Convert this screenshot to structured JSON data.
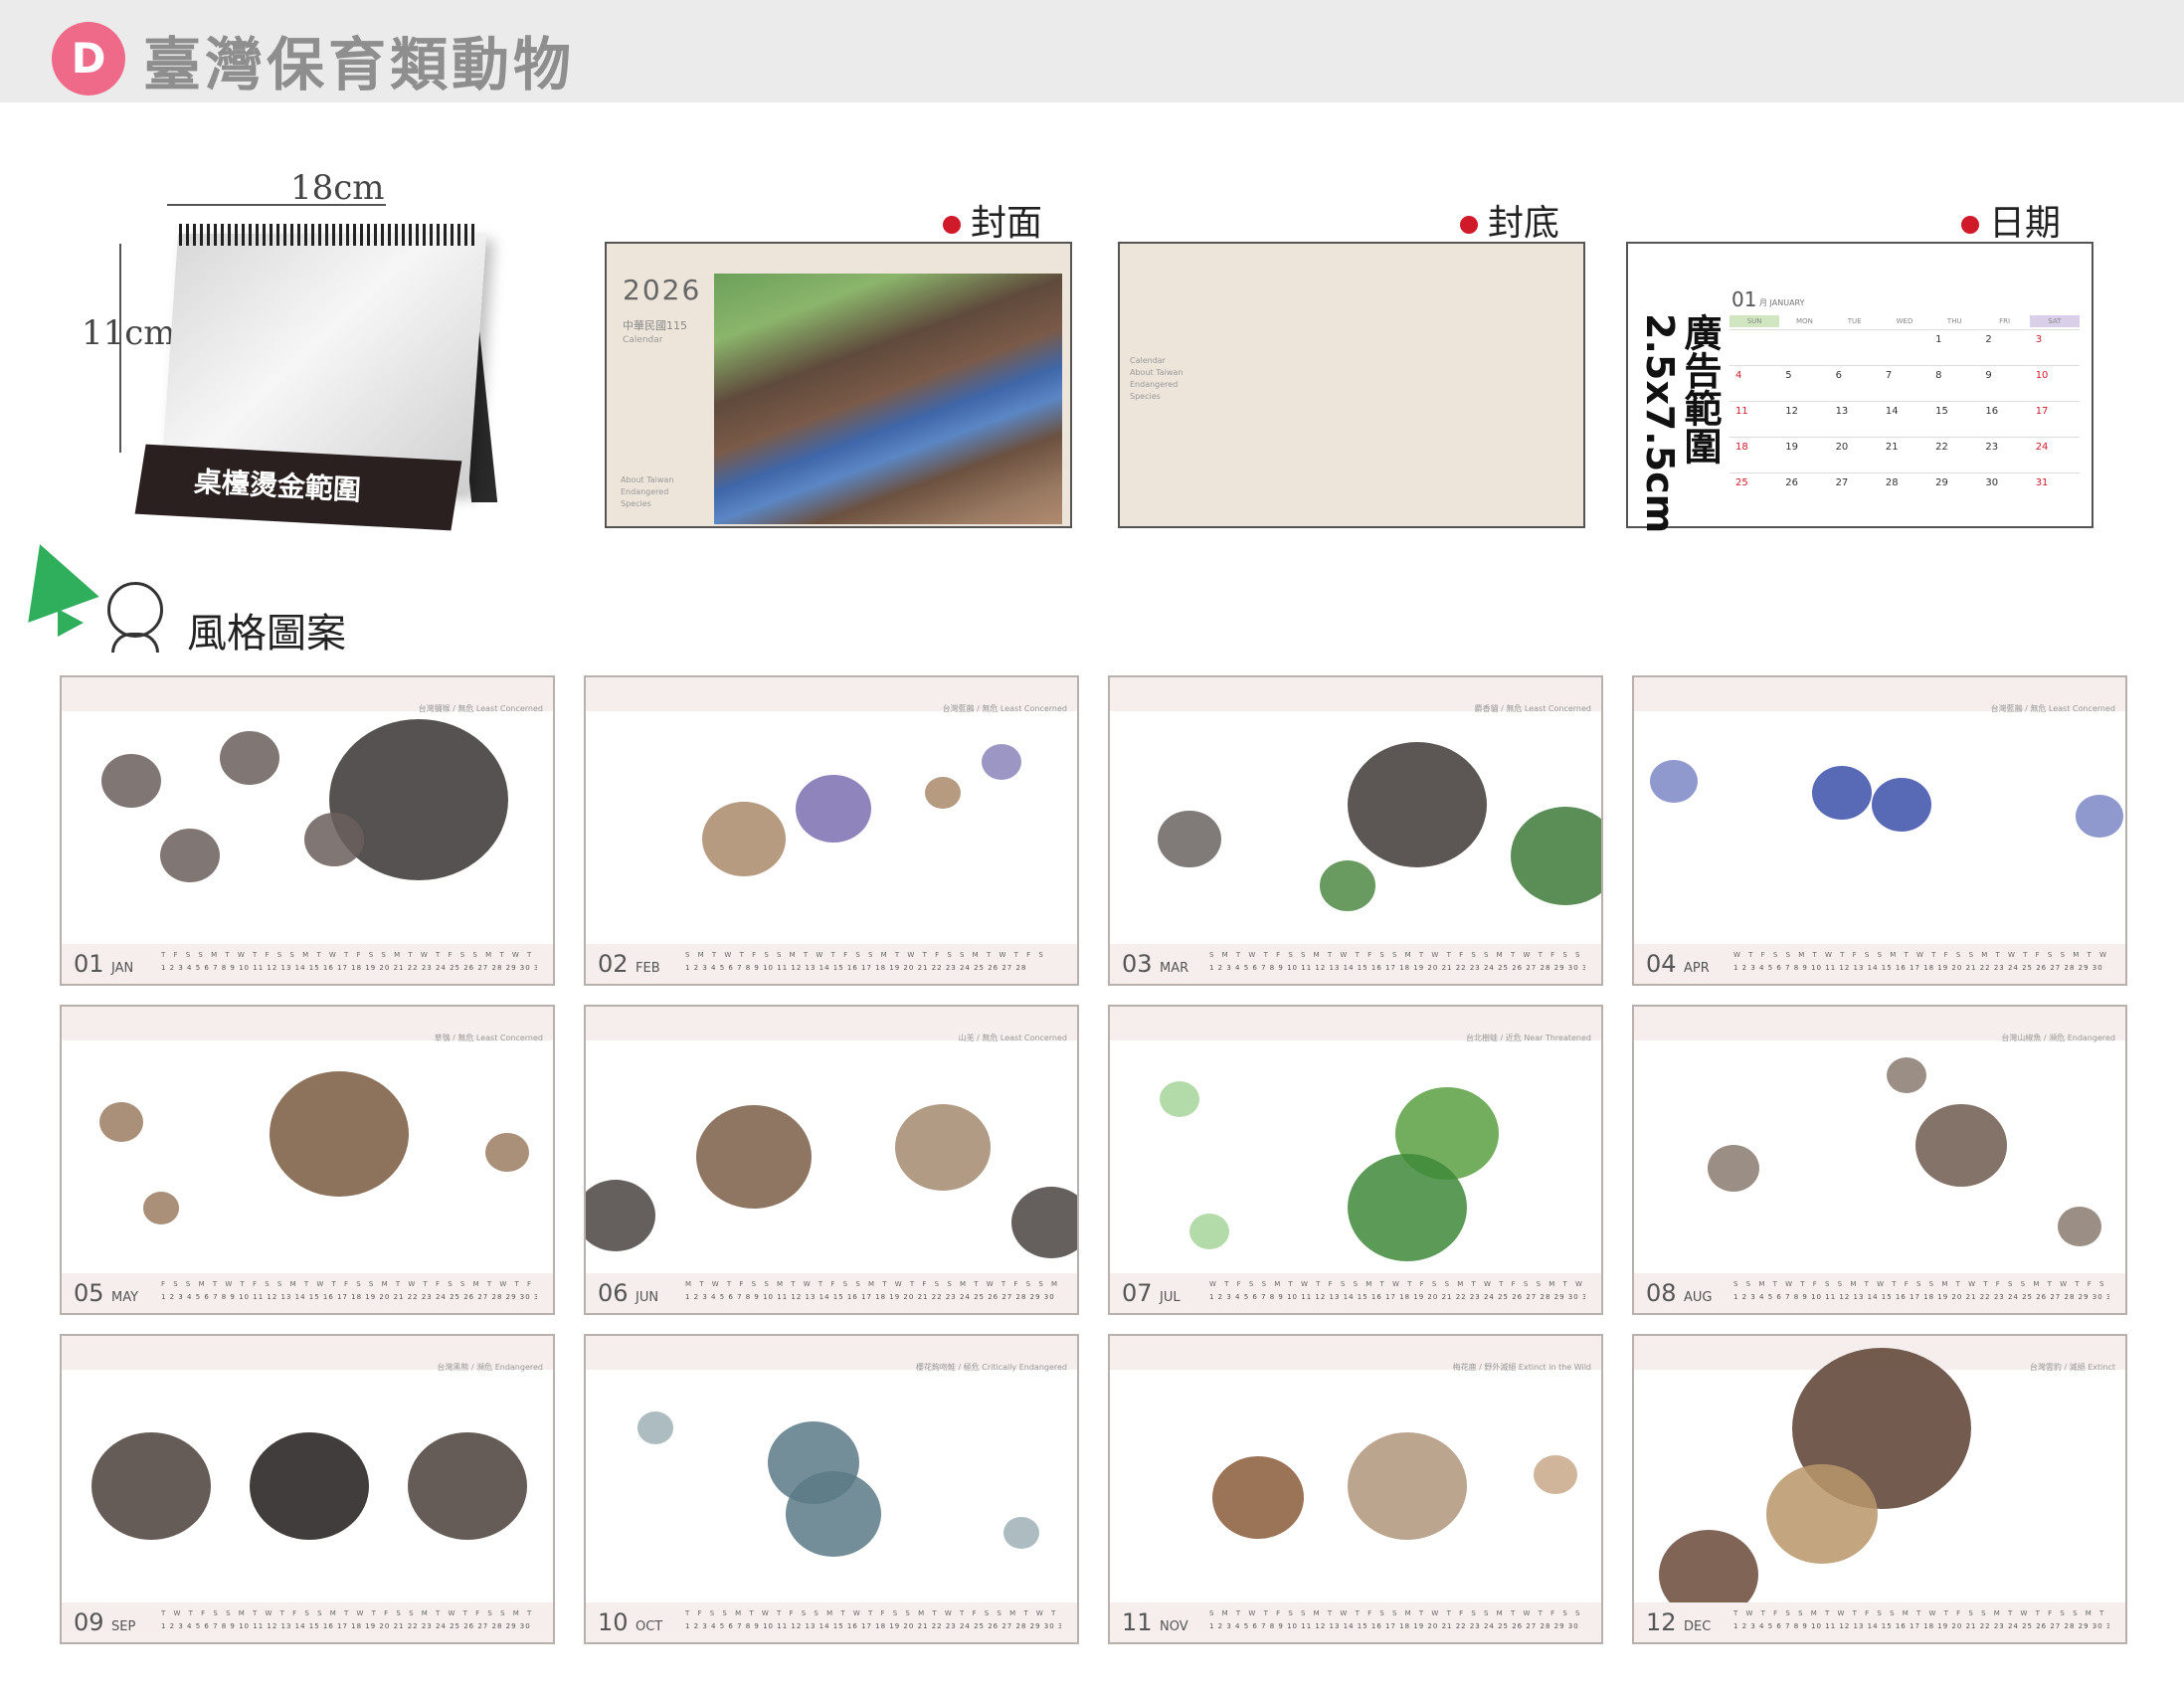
{
  "header": {
    "badge": "D",
    "title": "臺灣保育類動物"
  },
  "desk": {
    "width_label": "18cm",
    "height_label": "11cm",
    "base_label": "桌檯燙金範圍"
  },
  "previews": {
    "cover": {
      "label": "封面",
      "year": "2026",
      "roc": "中華民國115",
      "cal": "Calendar",
      "about": "About Taiwan Endangered Species"
    },
    "back": {
      "label": "封底",
      "text": "Calendar About Taiwan Endangered Species"
    },
    "date": {
      "label": "日期",
      "ad": "廣告範圍2.5x7.5cm",
      "month": "01",
      "monthname": "月 JANUARY",
      "weekdays": [
        "SUN",
        "MON",
        "TUE",
        "WED",
        "THU",
        "FRI",
        "SAT"
      ],
      "rows": [
        [
          "",
          "",
          "",
          "",
          "1",
          "2",
          "3"
        ],
        [
          "4",
          "5",
          "6",
          "7",
          "8",
          "9",
          "10"
        ],
        [
          "11",
          "12",
          "13",
          "14",
          "15",
          "16",
          "17"
        ],
        [
          "18",
          "19",
          "20",
          "21",
          "22",
          "23",
          "24"
        ],
        [
          "25",
          "26",
          "27",
          "28",
          "29",
          "30",
          "31"
        ]
      ]
    }
  },
  "style": {
    "title": "風格圖案"
  },
  "months": [
    {
      "num": "01",
      "abbr": "JAN",
      "caption": "台灣獼猴 / 無危 Least Concerned",
      "weekdays": "T F S S M T W T F S S M T W T F S S M T W T F S S M T W T F S",
      "days": "1 2 3 4 5 6 7 8 9 10 11 12 13 14 15 16 17 18 19 20 21 22 23 24 25 26 27 28 29 30 31"
    },
    {
      "num": "02",
      "abbr": "FEB",
      "caption": "台灣藍鵲 / 無危 Least Concerned",
      "weekdays": "S M T W T F S S M T W T F S S M T W T F S S M T W T F S",
      "days": "1 2 3 4 5 6 7 8 9 10 11 12 13 14 15 16 17 18 19 20 21 22 23 24 25 26 27 28"
    },
    {
      "num": "03",
      "abbr": "MAR",
      "caption": "麝香貓 / 無危 Least Concerned",
      "weekdays": "S M T W T F S S M T W T F S S M T W T F S S M T W T F S S M T",
      "days": "1 2 3 4 5 6 7 8 9 10 11 12 13 14 15 16 17 18 19 20 21 22 23 24 25 26 27 28 29 30 31"
    },
    {
      "num": "04",
      "abbr": "APR",
      "caption": "台灣藍鵲 / 無危 Least Concerned",
      "weekdays": "W T F S S M T W T F S S M T W T F S S M T W T F S S M T W T",
      "days": "1 2 3 4 5 6 7 8 9 10 11 12 13 14 15 16 17 18 19 20 21 22 23 24 25 26 27 28 29 30"
    },
    {
      "num": "05",
      "abbr": "MAY",
      "caption": "草鴞 / 無危 Least Concerned",
      "weekdays": "F S S M T W T F S S M T W T F S S M T W T F S S M T W T F S S",
      "days": "1 2 3 4 5 6 7 8 9 10 11 12 13 14 15 16 17 18 19 20 21 22 23 24 25 26 27 28 29 30 31"
    },
    {
      "num": "06",
      "abbr": "JUN",
      "caption": "山羌 / 無危 Least Concerned",
      "weekdays": "M T W T F S S M T W T F S S M T W T F S S M T W T F S S M T",
      "days": "1 2 3 4 5 6 7 8 9 10 11 12 13 14 15 16 17 18 19 20 21 22 23 24 25 26 27 28 29 30"
    },
    {
      "num": "07",
      "abbr": "JUL",
      "caption": "台北樹蛙 / 近危 Near Threatened",
      "weekdays": "W T F S S M T W T F S S M T W T F S S M T W T F S S M T W T F",
      "days": "1 2 3 4 5 6 7 8 9 10 11 12 13 14 15 16 17 18 19 20 21 22 23 24 25 26 27 28 29 30 31"
    },
    {
      "num": "08",
      "abbr": "AUG",
      "caption": "台灣山椒魚 / 瀕危 Endangered",
      "weekdays": "S S M T W T F S S M T W T F S S M T W T F S S M T W T F S S M",
      "days": "1 2 3 4 5 6 7 8 9 10 11 12 13 14 15 16 17 18 19 20 21 22 23 24 25 26 27 28 29 30 31"
    },
    {
      "num": "09",
      "abbr": "SEP",
      "caption": "台灣黑熊 / 瀕危 Endangered",
      "weekdays": "T W T F S S M T W T F S S M T W T F S S M T W T F S S M T W",
      "days": "1 2 3 4 5 6 7 8 9 10 11 12 13 14 15 16 17 18 19 20 21 22 23 24 25 26 27 28 29 30"
    },
    {
      "num": "10",
      "abbr": "OCT",
      "caption": "櫻花鉤吻鮭 / 極危 Critically Endangered",
      "weekdays": "T F S S M T W T F S S M T W T F S S M T W T F S S M T W T F S",
      "days": "1 2 3 4 5 6 7 8 9 10 11 12 13 14 15 16 17 18 19 20 21 22 23 24 25 26 27 28 29 30 31"
    },
    {
      "num": "11",
      "abbr": "NOV",
      "caption": "梅花鹿 / 野外滅絕 Extinct in the Wild",
      "weekdays": "S M T W T F S S M T W T F S S M T W T F S S M T W T F S S M",
      "days": "1 2 3 4 5 6 7 8 9 10 11 12 13 14 15 16 17 18 19 20 21 22 23 24 25 26 27 28 29 30"
    },
    {
      "num": "12",
      "abbr": "DEC",
      "caption": "台灣雲豹 / 滅絕 Extinct",
      "weekdays": "T W T F S S M T W T F S S M T W T F S S M T W T F S S M T W T",
      "days": "1 2 3 4 5 6 7 8 9 10 11 12 13 14 15 16 17 18 19 20 21 22 23 24 25 26 27 28 29 30 31"
    }
  ],
  "colors": {
    "badge": "#ee6a88",
    "accent_dot": "#d01a2a",
    "tile_band": "#f5eeec",
    "cover_bg": "#ede4da"
  }
}
